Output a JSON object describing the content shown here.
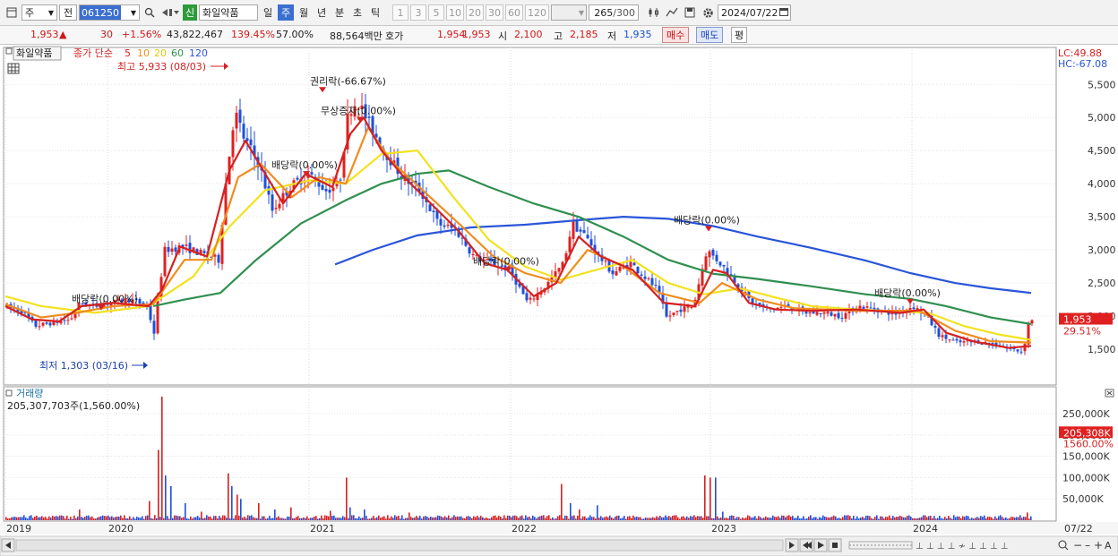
{
  "toolbar": {
    "period_main": "주",
    "prefix": "전",
    "stock_code": "061250",
    "new_badge": "신",
    "stock_name": "화일약품",
    "periods": [
      "일",
      "주",
      "월",
      "년",
      "분",
      "초",
      "틱"
    ],
    "selected_period": "주",
    "intervals": [
      "1",
      "3",
      "5",
      "10",
      "20",
      "30",
      "60",
      "120"
    ],
    "count": "265",
    "count_max": "/300",
    "date": "2024/07/22"
  },
  "quote": {
    "price": "1,953",
    "change_arrow": "▲",
    "change": "30",
    "change_pct": "+1.56%",
    "volume": "43,822,467",
    "volume_ratio": "139.45%",
    "turnover": "57.00%",
    "amount": "88,564백만",
    "hoga_label": "호가",
    "ask": "1,954",
    "bid": "1,953",
    "open_label": "시",
    "open": "2,100",
    "high_label": "고",
    "high": "2,185",
    "low_label": "저",
    "low": "1,935",
    "buy_label": "매수",
    "sell_label": "매도",
    "eval_label": "평"
  },
  "chart_data": {
    "type": "candlestick",
    "price_panel": {
      "legend": {
        "name": "화일약품",
        "ma_label": "종가 단순",
        "ma_periods": [
          "5",
          "10",
          "20",
          "60",
          "120"
        ],
        "ma_colors": [
          "#d62020",
          "#f08c1e",
          "#f2e21e",
          "#2f8f4f",
          "#2a55d8"
        ]
      },
      "y_ticks": [
        "5,500",
        "5,000",
        "4,500",
        "4,000",
        "3,500",
        "3,000",
        "2,500",
        "2,000",
        "1,500"
      ],
      "y_tick_values": [
        5500,
        5000,
        4500,
        4000,
        3500,
        3000,
        2500,
        2000,
        1500
      ],
      "ylim": [
        1000,
        5950
      ],
      "lc": "LC:49.88",
      "hc": "HC:-67.08",
      "current_price": "1,953",
      "current_price_value": 1953,
      "current_pct": "29.51%",
      "high_note": "최고 5,933 (08/03)",
      "low_note": "최저 1,303 (03/16)",
      "annotations": [
        {
          "text": "배당락(0.00%)",
          "x": "2019-12",
          "y": 2210
        },
        {
          "text": "권리락(-66.67%)",
          "x": "2020-12",
          "y": 5500
        },
        {
          "text": "무상증자(0.00%)",
          "x": "2021-02",
          "y": 5050
        },
        {
          "text": "배당락(0.00%)",
          "x": "2020-12",
          "y": 4230
        },
        {
          "text": "배당락(0.00%)",
          "x": "2021-12",
          "y": 2780
        },
        {
          "text": "배당락(0.00%)",
          "x": "2022-12",
          "y": 3400
        },
        {
          "text": "배당락(0.00%)",
          "x": "2023-12",
          "y": 2300
        }
      ],
      "price_path": [
        [
          0,
          2150
        ],
        [
          20,
          2080
        ],
        [
          35,
          1850
        ],
        [
          55,
          1900
        ],
        [
          75,
          1950
        ],
        [
          85,
          2200
        ],
        [
          100,
          2150
        ],
        [
          120,
          2200
        ],
        [
          140,
          2250
        ],
        [
          160,
          2160
        ],
        [
          168,
          1750
        ],
        [
          172,
          2250
        ],
        [
          180,
          3000
        ],
        [
          200,
          3050
        ],
        [
          220,
          2950
        ],
        [
          240,
          2850
        ],
        [
          248,
          4000
        ],
        [
          258,
          5100
        ],
        [
          268,
          4700
        ],
        [
          285,
          4300
        ],
        [
          300,
          3600
        ],
        [
          320,
          3950
        ],
        [
          340,
          4150
        ],
        [
          360,
          3900
        ],
        [
          375,
          4000
        ],
        [
          385,
          5100
        ],
        [
          395,
          5250
        ],
        [
          408,
          4900
        ],
        [
          425,
          4500
        ],
        [
          445,
          4100
        ],
        [
          465,
          3900
        ],
        [
          485,
          3400
        ],
        [
          505,
          3300
        ],
        [
          525,
          2900
        ],
        [
          545,
          2800
        ],
        [
          565,
          2700
        ],
        [
          585,
          2200
        ],
        [
          605,
          2450
        ],
        [
          625,
          2800
        ],
        [
          635,
          3400
        ],
        [
          650,
          3200
        ],
        [
          665,
          2900
        ],
        [
          680,
          2650
        ],
        [
          700,
          2800
        ],
        [
          715,
          2600
        ],
        [
          730,
          2400
        ],
        [
          740,
          1980
        ],
        [
          755,
          2100
        ],
        [
          770,
          2150
        ],
        [
          785,
          3000
        ],
        [
          800,
          2800
        ],
        [
          815,
          2550
        ],
        [
          835,
          2200
        ],
        [
          855,
          2100
        ],
        [
          875,
          2150
        ],
        [
          895,
          2050
        ],
        [
          915,
          2050
        ],
        [
          935,
          2000
        ],
        [
          955,
          2150
        ],
        [
          975,
          2100
        ],
        [
          995,
          2030
        ],
        [
          1015,
          2150
        ],
        [
          1030,
          2000
        ],
        [
          1045,
          1700
        ],
        [
          1065,
          1600
        ],
        [
          1085,
          1620
        ],
        [
          1105,
          1580
        ],
        [
          1125,
          1500
        ],
        [
          1138,
          1460
        ],
        [
          1145,
          1953
        ]
      ],
      "ma5": [
        [
          0,
          2150
        ],
        [
          30,
          1950
        ],
        [
          60,
          1920
        ],
        [
          85,
          2150
        ],
        [
          120,
          2200
        ],
        [
          160,
          2150
        ],
        [
          175,
          2400
        ],
        [
          195,
          3050
        ],
        [
          225,
          2900
        ],
        [
          250,
          4200
        ],
        [
          268,
          4650
        ],
        [
          290,
          4150
        ],
        [
          310,
          3700
        ],
        [
          335,
          4150
        ],
        [
          365,
          3950
        ],
        [
          385,
          4750
        ],
        [
          400,
          5000
        ],
        [
          420,
          4500
        ],
        [
          445,
          4100
        ],
        [
          475,
          3700
        ],
        [
          505,
          3300
        ],
        [
          535,
          2800
        ],
        [
          560,
          2700
        ],
        [
          590,
          2300
        ],
        [
          615,
          2500
        ],
        [
          640,
          3200
        ],
        [
          665,
          2900
        ],
        [
          700,
          2700
        ],
        [
          735,
          2200
        ],
        [
          770,
          2150
        ],
        [
          790,
          2700
        ],
        [
          805,
          2650
        ],
        [
          830,
          2200
        ],
        [
          860,
          2100
        ],
        [
          900,
          2080
        ],
        [
          950,
          2100
        ],
        [
          1000,
          2050
        ],
        [
          1025,
          2100
        ],
        [
          1050,
          1750
        ],
        [
          1080,
          1620
        ],
        [
          1120,
          1520
        ],
        [
          1145,
          1550
        ]
      ],
      "ma10": [
        [
          0,
          2180
        ],
        [
          40,
          1980
        ],
        [
          80,
          2050
        ],
        [
          120,
          2150
        ],
        [
          165,
          2180
        ],
        [
          200,
          2850
        ],
        [
          230,
          2850
        ],
        [
          260,
          4100
        ],
        [
          285,
          4300
        ],
        [
          320,
          3800
        ],
        [
          350,
          4100
        ],
        [
          380,
          4000
        ],
        [
          405,
          4850
        ],
        [
          430,
          4350
        ],
        [
          470,
          3850
        ],
        [
          510,
          3350
        ],
        [
          545,
          2900
        ],
        [
          580,
          2650
        ],
        [
          620,
          2500
        ],
        [
          650,
          3000
        ],
        [
          690,
          2750
        ],
        [
          730,
          2350
        ],
        [
          775,
          2200
        ],
        [
          800,
          2500
        ],
        [
          840,
          2250
        ],
        [
          880,
          2120
        ],
        [
          950,
          2080
        ],
        [
          1020,
          2080
        ],
        [
          1060,
          1780
        ],
        [
          1100,
          1620
        ],
        [
          1145,
          1600
        ]
      ],
      "ma20": [
        [
          0,
          2300
        ],
        [
          40,
          2150
        ],
        [
          100,
          2050
        ],
        [
          160,
          2150
        ],
        [
          210,
          2600
        ],
        [
          250,
          3350
        ],
        [
          290,
          3900
        ],
        [
          340,
          4050
        ],
        [
          380,
          4000
        ],
        [
          420,
          4450
        ],
        [
          460,
          4500
        ],
        [
          500,
          3800
        ],
        [
          540,
          3150
        ],
        [
          580,
          2750
        ],
        [
          620,
          2550
        ],
        [
          660,
          2700
        ],
        [
          700,
          2850
        ],
        [
          740,
          2500
        ],
        [
          780,
          2330
        ],
        [
          820,
          2420
        ],
        [
          860,
          2280
        ],
        [
          900,
          2150
        ],
        [
          950,
          2100
        ],
        [
          1000,
          2070
        ],
        [
          1030,
          2050
        ],
        [
          1070,
          1850
        ],
        [
          1110,
          1720
        ],
        [
          1145,
          1640
        ]
      ],
      "ma60": [
        [
          165,
          2150
        ],
        [
          200,
          2250
        ],
        [
          240,
          2350
        ],
        [
          280,
          2850
        ],
        [
          330,
          3400
        ],
        [
          380,
          3750
        ],
        [
          420,
          4000
        ],
        [
          460,
          4150
        ],
        [
          495,
          4200
        ],
        [
          540,
          3950
        ],
        [
          590,
          3700
        ],
        [
          640,
          3500
        ],
        [
          690,
          3200
        ],
        [
          740,
          2850
        ],
        [
          790,
          2640
        ],
        [
          840,
          2560
        ],
        [
          900,
          2450
        ],
        [
          960,
          2330
        ],
        [
          1010,
          2260
        ],
        [
          1050,
          2150
        ],
        [
          1100,
          1980
        ],
        [
          1145,
          1880
        ]
      ],
      "ma120": [
        [
          368,
          2780
        ],
        [
          410,
          3000
        ],
        [
          460,
          3220
        ],
        [
          520,
          3340
        ],
        [
          580,
          3380
        ],
        [
          640,
          3450
        ],
        [
          690,
          3500
        ],
        [
          740,
          3470
        ],
        [
          790,
          3360
        ],
        [
          840,
          3200
        ],
        [
          900,
          3030
        ],
        [
          960,
          2840
        ],
        [
          1010,
          2650
        ],
        [
          1060,
          2500
        ],
        [
          1100,
          2420
        ],
        [
          1145,
          2350
        ]
      ]
    },
    "volume_panel": {
      "legend": "거래량",
      "total": "205,307,703주(1,560.00%)",
      "y_ticks": [
        "250,000K",
        "200,000K",
        "150,000K",
        "100,000K",
        "50,000K"
      ],
      "y_tick_values": [
        250000,
        200000,
        150000,
        100000,
        50000
      ],
      "ylim": [
        0,
        290000
      ],
      "current_volume": "205,308K",
      "current_volume_value": 205308,
      "current_pct": "1560.00%",
      "spikes": [
        [
          82,
          25000,
          "red"
        ],
        [
          135,
          30000,
          "red"
        ],
        [
          160,
          45000,
          "red"
        ],
        [
          170,
          165000,
          "red"
        ],
        [
          174,
          290000,
          "red"
        ],
        [
          178,
          105000,
          "blue"
        ],
        [
          184,
          80000,
          "blue"
        ],
        [
          200,
          40000,
          "blue"
        ],
        [
          218,
          20000,
          "red"
        ],
        [
          248,
          110000,
          "red"
        ],
        [
          252,
          80000,
          "blue"
        ],
        [
          258,
          60000,
          "red"
        ],
        [
          262,
          50000,
          "blue"
        ],
        [
          282,
          40000,
          "red"
        ],
        [
          300,
          25000,
          "blue"
        ],
        [
          318,
          30000,
          "red"
        ],
        [
          362,
          22000,
          "red"
        ],
        [
          380,
          100000,
          "red"
        ],
        [
          384,
          30000,
          "blue"
        ],
        [
          400,
          25000,
          "blue"
        ],
        [
          450,
          18000,
          "red"
        ],
        [
          500,
          12000,
          "blue"
        ],
        [
          620,
          85000,
          "red"
        ],
        [
          630,
          40000,
          "blue"
        ],
        [
          640,
          25000,
          "red"
        ],
        [
          655,
          60000,
          "red"
        ],
        [
          660,
          35000,
          "blue"
        ],
        [
          780,
          105000,
          "red"
        ],
        [
          786,
          100000,
          "red"
        ],
        [
          792,
          100000,
          "blue"
        ],
        [
          800,
          20000,
          "blue"
        ],
        [
          940,
          12000,
          "red"
        ],
        [
          1140,
          18000,
          "red"
        ],
        [
          1145,
          205308,
          "red"
        ]
      ]
    },
    "x_ticks": [
      "2019",
      "2020",
      "2021",
      "2022",
      "2023",
      "2024",
      "07/22"
    ]
  }
}
